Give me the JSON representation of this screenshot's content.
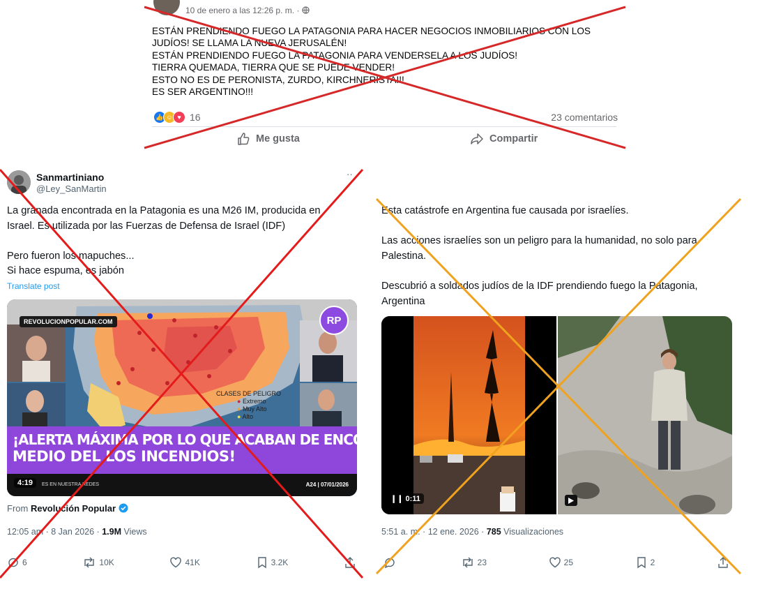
{
  "facebook_post": {
    "meta": "10 de enero a las 12:26 p. m. · ",
    "lines": [
      "ESTÁN PRENDIENDO FUEGO LA PATAGONIA PARA HACER NEGOCIOS INMOBILIARIOS CON LOS",
      "JUDÍOS! SE LLAMA LA NUEVA JERUSALÉN!",
      "ESTÁN PRENDIENDO FUEGO LA PATAGONIA PARA VENDERSELA A LOS JUDÍOS!",
      "TIERRA QUEMADA, TIERRA QUE SE PUEDE VENDER!",
      "ESTO NO ES DE PERONISTA, ZURDO, KIRCHNERISTA!!!",
      "ES SER ARGENTINO!!!"
    ],
    "reaction_count": "16",
    "comments": "23 comentarios",
    "like_label": "Me gusta",
    "share_label": "Compartir"
  },
  "tweet_left": {
    "name": "Sanmartiniano",
    "handle": "@Ley_SanMartin",
    "more": "··",
    "body": [
      "La granada encontrada en la Patagonia es una M26 IM, producida en",
      "Israel. Es utilizada por las Fuerzas de Defensa de Israel (IDF)",
      "",
      "Pero fueron los mapuches...",
      "Si hace espuma, es jabón"
    ],
    "translate": "Translate post",
    "media": {
      "site_chip": "REVOLUCIONPOPULAR.COM",
      "logo": "RP",
      "legend_title": "CLASES DE PELIGRO",
      "legend_items": [
        {
          "label": "Extremo",
          "color": "#d9262b"
        },
        {
          "label": "Muy Alto",
          "color": "#f0a12c"
        },
        {
          "label": "Alto",
          "color": "#e7e03c"
        }
      ],
      "headline_1": "¡ALERTA MÁXIMA POR LO QUE ACABAN DE ENCONTRAR EN CHUBUT EN",
      "headline_2": "MEDIO DEL LOS INCENDIOS!",
      "duration": "4:19",
      "ticker": "ES EN NUESTRA REDES",
      "channel": "A24 | 07/01/2026"
    },
    "from_prefix": "From ",
    "from_source": "Revolución Popular",
    "timestamp": "12:05 am · 8 Jan 2026 · ",
    "views_count": "1.9M",
    "views_label": " Views",
    "replies": "6",
    "reposts": "10K",
    "likes": "41K",
    "bookmarks": "3.2K"
  },
  "tweet_right": {
    "body": [
      "Esta catástrofe en Argentina fue causada por israelíes.",
      "",
      "Las acciones israelíes son un peligro para la humanidad, no solo para",
      "Palestina.",
      "",
      "Descubrió a soldados judíos de la IDF prendiendo fuego la Patagonia,",
      "Argentina"
    ],
    "video_duration": "0:11",
    "timestamp": "5:51 a. m. · 12 ene. 2026 · ",
    "views_count": "785",
    "views_label": " Visualizaciones",
    "reposts": "23",
    "likes": "25",
    "bookmarks": "2"
  },
  "colors": {
    "facebook_cross": "#d62828",
    "left_tweet_cross": "#e31b1b",
    "right_tweet_cross": "#f0a21f",
    "verified": "#1d9bf0",
    "banner_purple": "#8e46db"
  }
}
